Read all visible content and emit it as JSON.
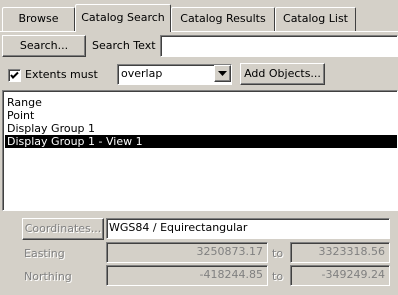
{
  "tabs": [
    {
      "label": "Browse",
      "active": false
    },
    {
      "label": "Catalog Search",
      "active": true
    },
    {
      "label": "Catalog Results",
      "active": false
    },
    {
      "label": "Catalog List",
      "active": false
    }
  ],
  "search": {
    "button_label": "Search...",
    "text_label": "Search Text",
    "text_value": ""
  },
  "extents": {
    "checkbox_label": "Extents must",
    "checked": true,
    "mode_value": "overlap",
    "add_objects_label": "Add Objects..."
  },
  "objects_list": [
    {
      "label": "Range",
      "selected": false
    },
    {
      "label": "Point",
      "selected": false
    },
    {
      "label": "Display Group 1",
      "selected": false
    },
    {
      "label": "Display Group 1 - View 1",
      "selected": true
    }
  ],
  "coordinates": {
    "button_label": "Coordinates...",
    "system_value": "WGS84 / Equirectangular",
    "easting_label": "Easting",
    "easting_from": "3250873.17",
    "easting_to": "3323318.56",
    "northing_label": "Northing",
    "northing_from": "-418244.85",
    "northing_to": "-349249.24",
    "to_label": "to"
  }
}
